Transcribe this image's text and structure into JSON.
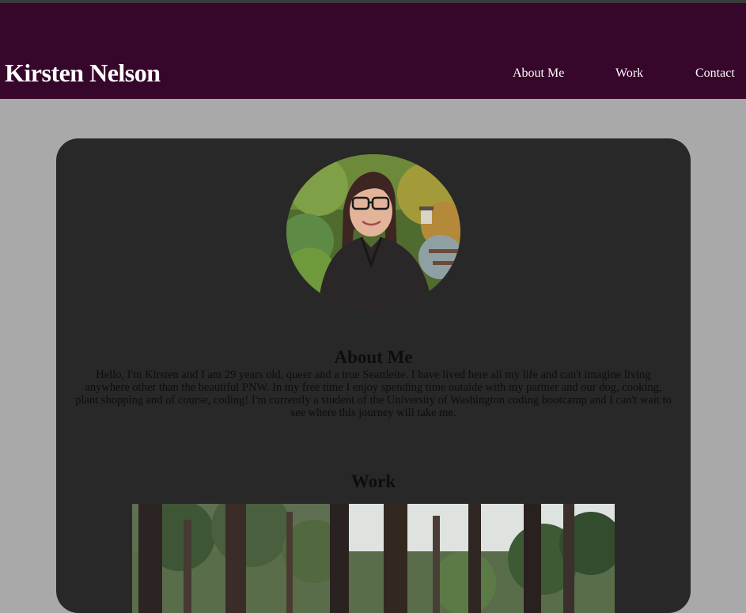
{
  "site": {
    "title": "Kirsten Nelson"
  },
  "nav": {
    "items": [
      "About Me",
      "Work",
      "Contact"
    ]
  },
  "about": {
    "heading": "About Me",
    "text": "Hello, I'm Kirsten and I am 29 years old, queer and a true Seattleite. I have lived here all my life and can't imagine living anywhere other than the beautiful PNW. In my free time I enjoy spending time outaide with my partner and our dog, cooking, plant shopping and of course, coding! I'm currently a student of the University of Washington coding bootcamp and I can't wait to see where this journey will take me."
  },
  "work": {
    "heading": "Work"
  },
  "colors": {
    "header_bg": "#36062b",
    "page_bg": "#a9a9a9",
    "card_bg": "#282828",
    "text_light": "#ffffff",
    "text_dark": "#0d0d0d"
  },
  "images": {
    "avatar": "profile-photo",
    "work_preview": "forest-photo"
  }
}
